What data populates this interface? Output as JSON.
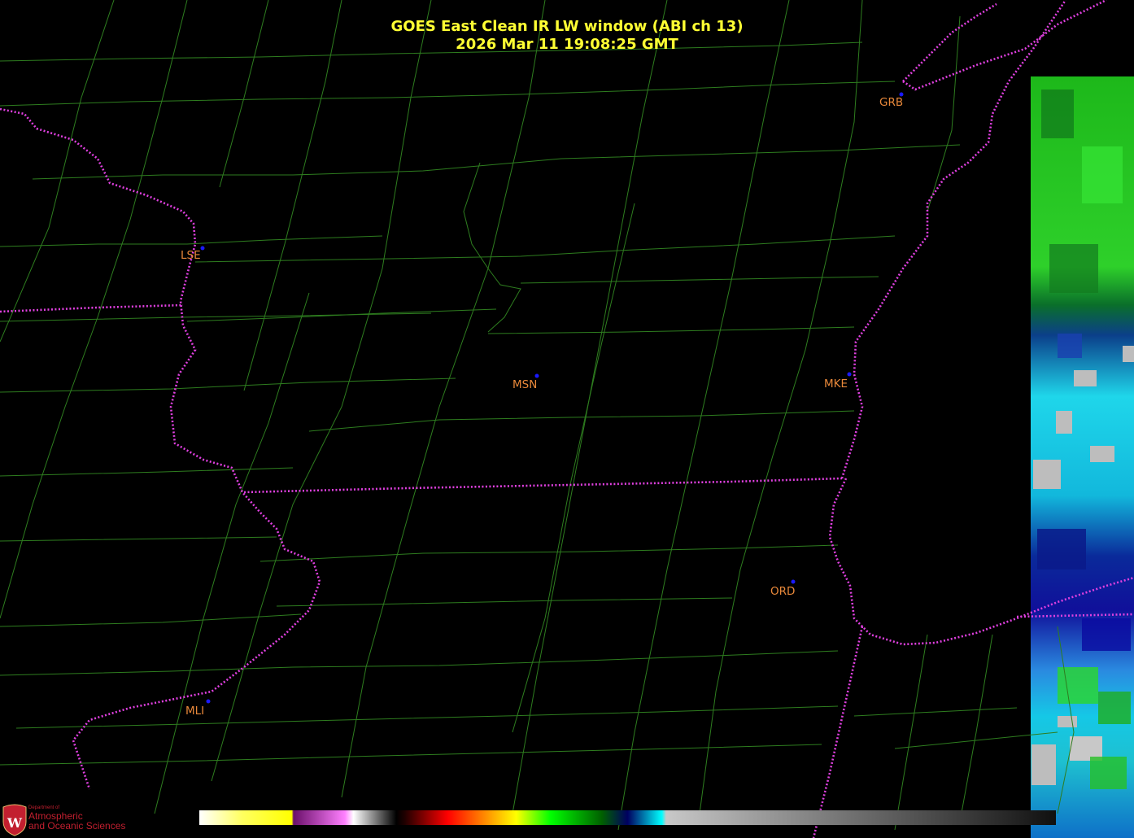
{
  "header": {
    "title_line1": "GOES East Clean IR LW window (ABI ch 13)",
    "title_line2": "2026 Mar 11  19:08:25 GMT"
  },
  "cities": [
    {
      "code": "GRB"
    },
    {
      "code": "LSE"
    },
    {
      "code": "MSN"
    },
    {
      "code": "MKE"
    },
    {
      "code": "ORD"
    },
    {
      "code": "MLI"
    }
  ],
  "logo": {
    "line1": "Department of",
    "line2": "Atmospheric",
    "line3": "and Oceanic Sciences"
  },
  "colors": {
    "title": "#ffff33",
    "county_lines": "#2e7d1f",
    "state_borders": "#e040e0",
    "city_labels": "#e8883a",
    "city_markers": "#1a1aff"
  },
  "colorbar": {
    "stops": [
      "#ffffff",
      "#ffff40",
      "#ffff00",
      "#7a1a7a",
      "#ff80ff",
      "#ffffff",
      "#000000",
      "#200000",
      "#ff0000",
      "#ffa000",
      "#ffff00",
      "#00ff00",
      "#006000",
      "#000060",
      "#00ffff",
      "#c0c0c0",
      "#101010"
    ]
  }
}
